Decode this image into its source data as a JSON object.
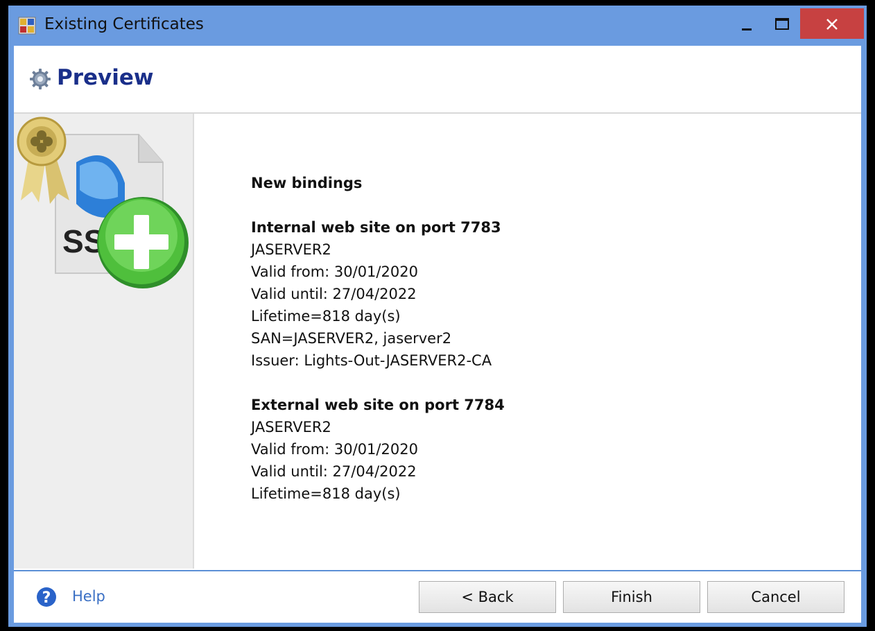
{
  "window": {
    "title": "Existing Certificates",
    "accent_color": "#6a9be0",
    "close_color": "#c74141"
  },
  "header": {
    "title": "Preview",
    "icon": "gear-icon"
  },
  "sidebar": {
    "art": "ssl-certificate-add-icon",
    "art_text": "SS"
  },
  "content": {
    "heading": "New bindings",
    "internal": {
      "title": "Internal web site on port 7783",
      "host": "JASERVER2",
      "valid_from": "Valid from: 30/01/2020",
      "valid_until": "Valid until: 27/04/2022",
      "lifetime": "Lifetime=818 day(s)",
      "san": "SAN=JASERVER2,  jaserver2",
      "issuer": "Issuer: Lights-Out-JASERVER2-CA"
    },
    "external": {
      "title": "External web site on port 7784",
      "host": "JASERVER2",
      "valid_from": "Valid from: 30/01/2020",
      "valid_until": "Valid until: 27/04/2022",
      "lifetime": "Lifetime=818 day(s)"
    }
  },
  "footer": {
    "help_label": "Help",
    "back_label": "<  Back",
    "finish_label": "Finish",
    "cancel_label": "Cancel"
  }
}
